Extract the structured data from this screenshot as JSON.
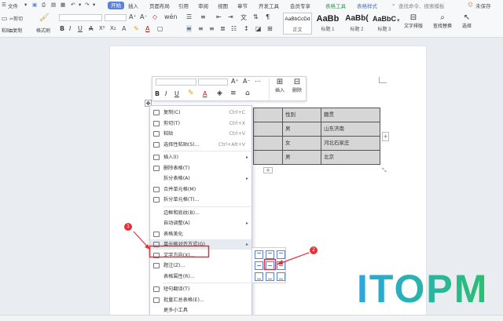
{
  "menu_tabs": [
    "文件",
    "开始",
    "插入",
    "页面布局",
    "引用",
    "审阅",
    "视图",
    "章节",
    "开发工具",
    "会员专享",
    "表格工具",
    "表格样式"
  ],
  "menu_file_label": "文件",
  "search_placeholder": "查找命令、搜索模板",
  "user_status": "未保存",
  "ribbon": {
    "cut": "剪切",
    "copy": "复制",
    "format_painter": "格式刷",
    "paste": "粘贴",
    "style_previews": [
      {
        "preview": "AaBbCcDd",
        "caption": "正文"
      },
      {
        "preview": "AaBb",
        "caption": "标题 1"
      },
      {
        "preview": "AaBb(",
        "caption": "标题 2"
      },
      {
        "preview": "AaBbC",
        "caption": "标题 3"
      }
    ],
    "text_layout": "文字排版",
    "find_replace": "查找替换",
    "select": "选择"
  },
  "mini_toolbar": {
    "insert": "插入",
    "delete": "删除"
  },
  "doc_table": {
    "rows": [
      [
        "",
        "性别",
        "籍贯"
      ],
      [
        "",
        "男",
        "山东济南"
      ],
      [
        "",
        "女",
        "河北石家庄"
      ],
      [
        "",
        "男",
        "北京"
      ]
    ],
    "add_symbol": "+"
  },
  "context_menu": [
    {
      "icon": "copy-icon",
      "label": "复制(C)",
      "shortcut": "Ctrl+C"
    },
    {
      "icon": "cut-icon",
      "label": "剪切(T)",
      "shortcut": "Ctrl+X"
    },
    {
      "icon": "paste-icon",
      "label": "粘贴",
      "shortcut": "Ctrl+V"
    },
    {
      "icon": "paste-special-icon",
      "label": "选择性粘贴(S)...",
      "shortcut": "Ctrl+Alt+V"
    },
    {
      "icon": "insert-icon",
      "label": "插入(I)",
      "arrow": true
    },
    {
      "icon": "delete-table-icon",
      "label": "删除表格(T)"
    },
    {
      "icon": "",
      "label": "拆分表格(A)",
      "arrow": true
    },
    {
      "icon": "merge-icon",
      "label": "合并单元格(M)"
    },
    {
      "icon": "split-icon",
      "label": "拆分单元格(T)..."
    },
    {
      "icon": "",
      "label": "边框和底纹(B)..."
    },
    {
      "icon": "",
      "label": "自动调整(A)",
      "arrow": true
    },
    {
      "icon": "beautify-icon",
      "label": "表格美化"
    },
    {
      "icon": "align-icon",
      "label": "单元格对齐方式(G)",
      "arrow": true
    },
    {
      "icon": "text-direction-icon",
      "label": "文字方向(X)..."
    },
    {
      "icon": "caption-icon",
      "label": "题注(Z)..."
    },
    {
      "icon": "",
      "label": "表格属性(R)..."
    },
    {
      "icon": "translate-icon",
      "label": "短句翻译(T)"
    },
    {
      "icon": "summary-icon",
      "label": "批量汇总表格(E)..."
    },
    {
      "icon": "",
      "label": "更多小工具"
    }
  ],
  "callouts": [
    "1",
    "2"
  ],
  "watermark": "ITOPM",
  "colors": {
    "accent": "#5b83d6",
    "highlight_box": "#e0343b",
    "table_fill": "#d6d6d6",
    "watermark_start": "#29a8e0",
    "watermark_end": "#2bbf6e"
  }
}
